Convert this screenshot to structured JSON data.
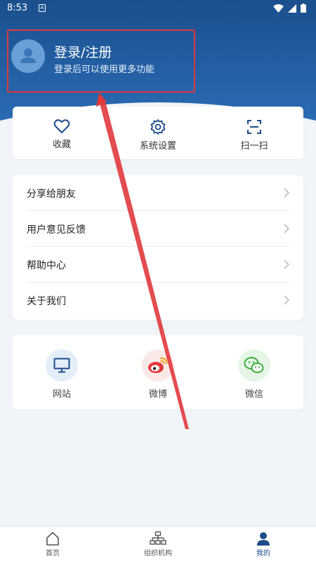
{
  "status_bar": {
    "time": "8:53",
    "notification_icon": "A"
  },
  "profile": {
    "title": "登录/注册",
    "subtitle": "登录后可以使用更多功能"
  },
  "quick_actions": [
    {
      "label": "收藏",
      "icon": "heart-icon"
    },
    {
      "label": "系统设置",
      "icon": "gear-icon"
    },
    {
      "label": "扫一扫",
      "icon": "scan-icon"
    }
  ],
  "menu": [
    {
      "label": "分享给朋友"
    },
    {
      "label": "用户意见反馈"
    },
    {
      "label": "帮助中心"
    },
    {
      "label": "关于我们"
    }
  ],
  "share": [
    {
      "label": "网站",
      "icon": "monitor-icon"
    },
    {
      "label": "微博",
      "icon": "weibo-icon"
    },
    {
      "label": "微信",
      "icon": "wechat-icon"
    }
  ],
  "bottom_nav": [
    {
      "label": "首页",
      "icon": "home-icon"
    },
    {
      "label": "组织机构",
      "icon": "org-chart-icon"
    },
    {
      "label": "我的",
      "icon": "user-icon",
      "active": true
    }
  ],
  "colors": {
    "header": "#1f5a9c",
    "accent": "#1d4c8a",
    "highlight": "#e0383d"
  }
}
